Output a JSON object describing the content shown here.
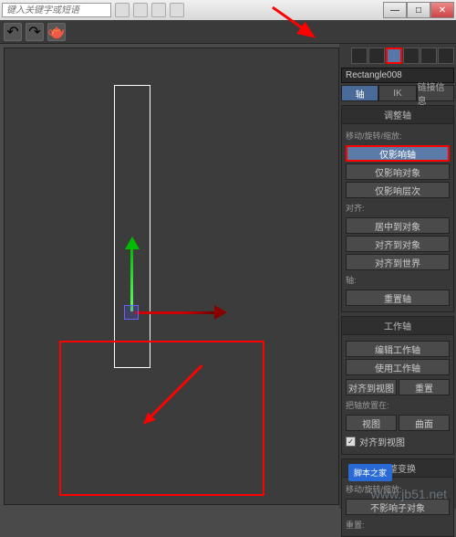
{
  "title": {
    "search_placeholder": "键入关键字或短语"
  },
  "win": {
    "min": "—",
    "max": "□",
    "close": "✕"
  },
  "object_name": "Rectangle008",
  "sub_tabs": {
    "pivot": "轴",
    "ik": "IK",
    "link": "链接信息"
  },
  "rollouts": {
    "adjust_pivot": {
      "title": "调整轴",
      "group_move": "移动/旋转/缩放:",
      "btn_pivot_only": "仅影响轴",
      "btn_object_only": "仅影响对象",
      "btn_hierarchy": "仅影响层次",
      "group_align": "对齐:",
      "btn_center": "居中到对象",
      "btn_align_obj": "对齐到对象",
      "btn_align_world": "对齐到世界",
      "group_axis": "轴:",
      "btn_reset": "重置轴"
    },
    "working_pivot": {
      "title": "工作轴",
      "btn_edit": "编辑工作轴",
      "btn_use": "使用工作轴",
      "btn_align_view": "对齐到视图",
      "btn_reset_wp": "重置",
      "label_place": "把轴放置在:",
      "btn_view": "视图",
      "btn_surface": "曲面",
      "chk_align_view": "对齐到视图"
    },
    "adjust_transform": {
      "title": "调整变换",
      "group_move": "移动/旋转/缩放:",
      "btn_no_affect": "不影响子对象",
      "label_reset": "重置:"
    }
  },
  "watermark": "www.jb51.net",
  "logo": "脚本之家"
}
